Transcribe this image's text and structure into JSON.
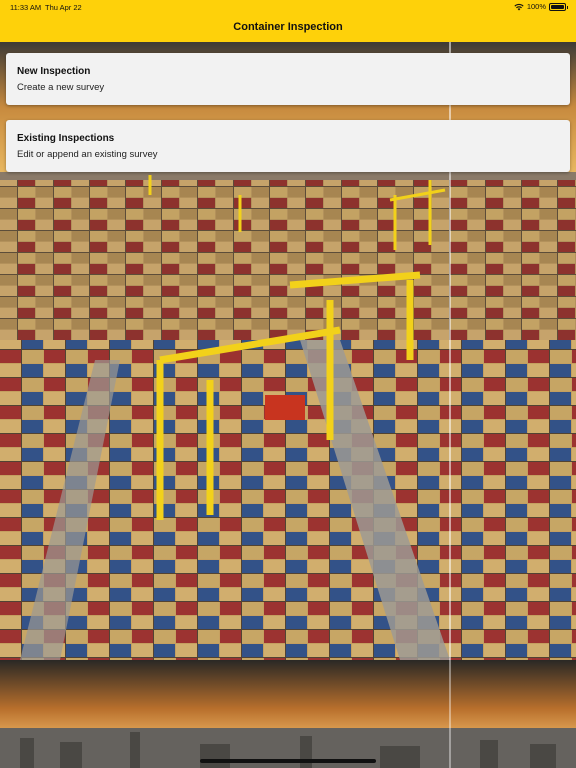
{
  "status_bar": {
    "time": "11:33 AM",
    "date": "Thu Apr 22",
    "battery": "100%",
    "icons": [
      "wifi-icon",
      "battery-icon"
    ]
  },
  "nav": {
    "title": "Container Inspection"
  },
  "menu": [
    {
      "title": "New Inspection",
      "subtitle": "Create a new survey"
    },
    {
      "title": "Existing Inspections",
      "subtitle": "Edit or append an existing survey"
    }
  ],
  "colors": {
    "accent": "#fed10a",
    "card": "#f2f2f2"
  }
}
